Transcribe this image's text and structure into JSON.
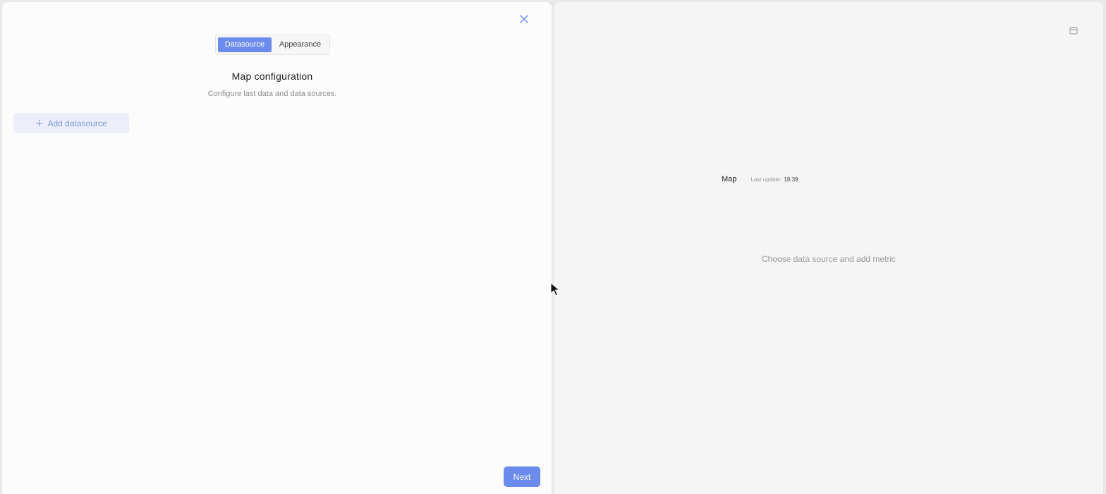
{
  "left": {
    "tabs": [
      {
        "label": "Datasource",
        "active": true
      },
      {
        "label": "Appearance",
        "active": false
      }
    ],
    "title": "Map configuration",
    "subtitle": "Configure last data and data sources.",
    "add_datasource_label": "Add datasource",
    "next_label": "Next",
    "close_icon": "close-icon"
  },
  "right": {
    "widget_title": "Map",
    "last_update_label": "Last update:",
    "last_update_time": "18:39",
    "empty_message": "Choose data source and add metric",
    "calendar_icon": "calendar-icon"
  },
  "colors": {
    "accent": "#6b8ced",
    "left_bg": "#fcfcfc",
    "right_bg": "#f5f5f5"
  }
}
